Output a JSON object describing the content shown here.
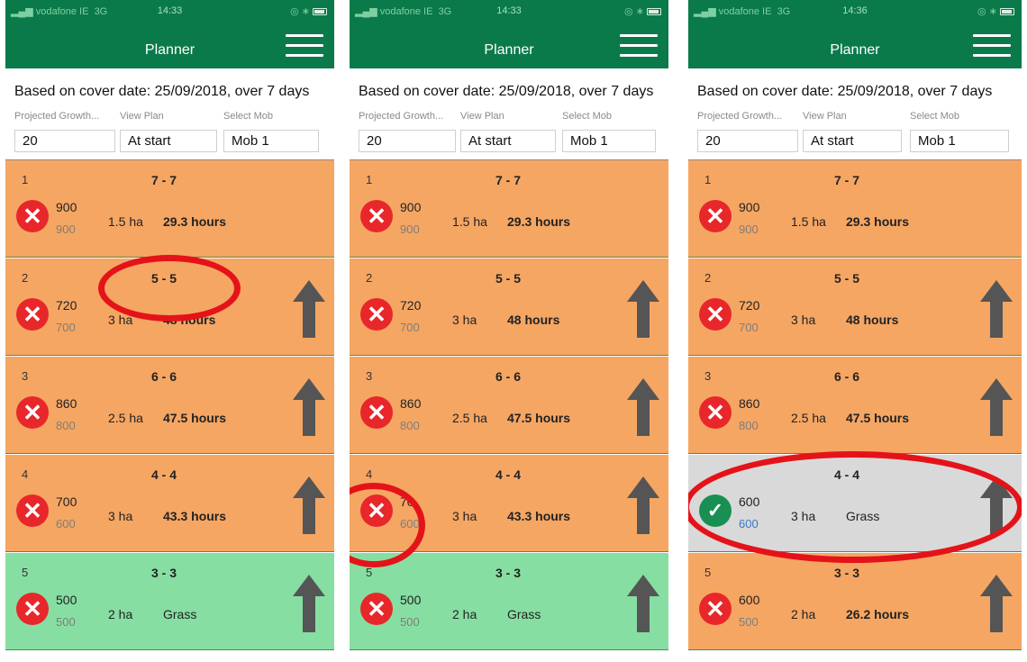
{
  "screens": [
    {
      "status": {
        "carrier": "vodafone IE",
        "network": "3G",
        "time": "14:33"
      },
      "header": {
        "title": "Planner"
      },
      "cover_text": "Based on cover date: 25/09/2018, over 7 days",
      "labels": {
        "growth": "Projected Growth...",
        "view": "View Plan",
        "mob": "Select Mob"
      },
      "fields": {
        "growth": "20",
        "view": "At start",
        "mob": "Mob 1"
      },
      "rows": [
        {
          "num": "1",
          "range": "7 - 7",
          "cover": "900",
          "target": "900",
          "area": "1.5 ha",
          "duration": "29.3 hours"
        },
        {
          "num": "2",
          "range": "5 - 5",
          "cover": "720",
          "target": "700",
          "area": "3 ha",
          "duration": "48 hours"
        },
        {
          "num": "3",
          "range": "6 - 6",
          "cover": "860",
          "target": "800",
          "area": "2.5 ha",
          "duration": "47.5 hours"
        },
        {
          "num": "4",
          "range": "4 - 4",
          "cover": "700",
          "target": "600",
          "area": "3 ha",
          "duration": "43.3 hours"
        },
        {
          "num": "5",
          "range": "3 - 3",
          "cover": "500",
          "target": "500",
          "area": "2 ha",
          "duration": "Grass"
        }
      ]
    },
    {
      "status": {
        "carrier": "vodafone IE",
        "network": "3G",
        "time": "14:33"
      },
      "header": {
        "title": "Planner"
      },
      "cover_text": "Based on cover date: 25/09/2018, over 7 days",
      "labels": {
        "growth": "Projected Growth...",
        "view": "View Plan",
        "mob": "Select Mob"
      },
      "fields": {
        "growth": "20",
        "view": "At start",
        "mob": "Mob 1"
      },
      "rows": [
        {
          "num": "1",
          "range": "7 - 7",
          "cover": "900",
          "target": "900",
          "area": "1.5 ha",
          "duration": "29.3 hours"
        },
        {
          "num": "2",
          "range": "5 - 5",
          "cover": "720",
          "target": "700",
          "area": "3 ha",
          "duration": "48 hours"
        },
        {
          "num": "3",
          "range": "6 - 6",
          "cover": "860",
          "target": "800",
          "area": "2.5 ha",
          "duration": "47.5 hours"
        },
        {
          "num": "4",
          "range": "4 - 4",
          "cover": "70",
          "target": "600",
          "area": "3 ha",
          "duration": "43.3 hours"
        },
        {
          "num": "5",
          "range": "3 - 3",
          "cover": "500",
          "target": "500",
          "area": "2 ha",
          "duration": "Grass"
        }
      ]
    },
    {
      "status": {
        "carrier": "vodafone IE",
        "network": "3G",
        "time": "14:36"
      },
      "header": {
        "title": "Planner"
      },
      "cover_text": "Based on cover date: 25/09/2018, over 7 days",
      "labels": {
        "growth": "Projected Growth...",
        "view": "View Plan",
        "mob": "Select Mob"
      },
      "fields": {
        "growth": "20",
        "view": "At start",
        "mob": "Mob 1"
      },
      "rows": [
        {
          "num": "1",
          "range": "7 - 7",
          "cover": "900",
          "target": "900",
          "area": "1.5 ha",
          "duration": "29.3 hours"
        },
        {
          "num": "2",
          "range": "5 - 5",
          "cover": "720",
          "target": "700",
          "area": "3 ha",
          "duration": "48 hours"
        },
        {
          "num": "3",
          "range": "6 - 6",
          "cover": "860",
          "target": "800",
          "area": "2.5 ha",
          "duration": "47.5 hours"
        },
        {
          "num": "4",
          "range": "4 - 4",
          "cover": "600",
          "target": "600",
          "area": "3 ha",
          "duration": "Grass"
        },
        {
          "num": "5",
          "range": "3 - 3",
          "cover": "600",
          "target": "500",
          "area": "2 ha",
          "duration": "26.2 hours"
        }
      ]
    }
  ],
  "icons": {
    "status_fail": "x-circle-icon",
    "status_ok": "check-circle-icon",
    "move": "arrow-up-icon",
    "menu": "hamburger-menu-icon"
  },
  "colors": {
    "header": "#0b7a4b",
    "row_orange": "#f5a663",
    "row_green": "#87dea2",
    "row_selected": "#d9d9d9",
    "fail": "#e8272b",
    "ok": "#1a8f53",
    "annotation": "#e41319"
  }
}
